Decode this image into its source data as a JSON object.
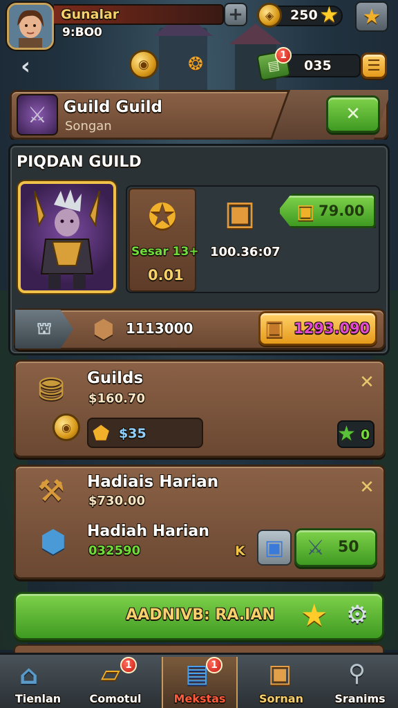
{
  "header": {
    "player_name": "Gunalar",
    "player_sub": "9:BO0",
    "currency_value": "250",
    "mail_value": "035",
    "mail_badge": "1"
  },
  "guild_card": {
    "title": "Guild Guild",
    "subtitle": "Songan"
  },
  "section_title": "PIQDAN GUILD",
  "hero_stats": {
    "season_label": "Sesar 13+",
    "season_value": "0.01",
    "timer": "100.36:07",
    "reward_value": "79.00"
  },
  "progress_bar": {
    "value": "1113000",
    "reward_value": "1293.090"
  },
  "guilds_panel": {
    "title": "Guilds",
    "amount": "$160.70",
    "gem_value": "$35",
    "side_value": "0"
  },
  "daily_panel": {
    "title": "Hadiais Harian",
    "amount": "$730.00",
    "sub_title": "Hadiah Harian",
    "sub_value": "032590",
    "k_label": "K",
    "button_value": "50"
  },
  "main_button": {
    "label": "AADNIVB: RA.IAN"
  },
  "bottom_nav": [
    {
      "label": "Tienlan",
      "badge": ""
    },
    {
      "label": "Comotul",
      "badge": "1"
    },
    {
      "label": "Mekstas",
      "badge": "1"
    },
    {
      "label": "Sornan",
      "badge": ""
    },
    {
      "label": "Sranims",
      "badge": ""
    }
  ],
  "colors": {
    "panel_brown": "#7a5339",
    "button_green": "#5cb832",
    "accent_gold": "#f1b02a",
    "nav_active": "#ff5a3c",
    "stat_green": "#6fdc3a"
  }
}
